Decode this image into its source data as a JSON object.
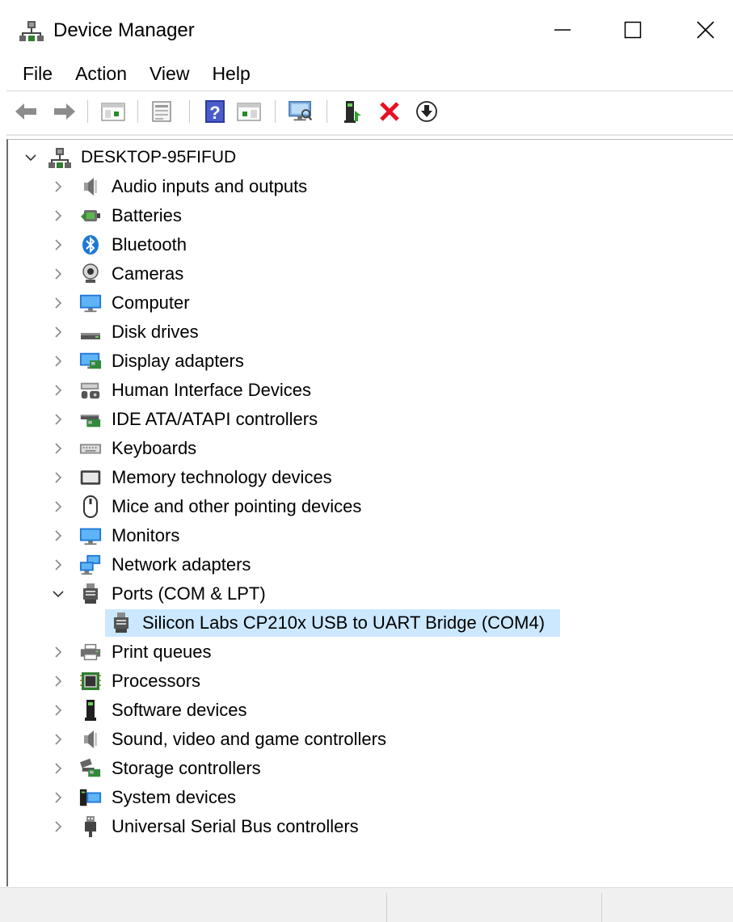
{
  "window": {
    "title": "Device Manager",
    "app_icon": "device-manager-icon",
    "controls": [
      "minimize-icon",
      "maximize-icon",
      "close-icon"
    ]
  },
  "menu": [
    "File",
    "Action",
    "View",
    "Help"
  ],
  "toolbar": [
    "back-arrow-icon",
    "forward-arrow-icon",
    "show-hide-console-tree-icon",
    "properties-icon",
    "help-icon",
    "action-pane-icon",
    "monitor-scan-icon",
    "update-driver-icon",
    "uninstall-x-icon",
    "download-driver-icon"
  ],
  "tree": {
    "root": "DESKTOP-95FIFUD",
    "categories": [
      {
        "label": "Audio inputs and outputs",
        "icon": "speaker-icon"
      },
      {
        "label": "Batteries",
        "icon": "battery-icon"
      },
      {
        "label": "Bluetooth",
        "icon": "bluetooth-icon"
      },
      {
        "label": "Cameras",
        "icon": "camera-icon"
      },
      {
        "label": "Computer",
        "icon": "computer-icon"
      },
      {
        "label": "Disk drives",
        "icon": "disk-drive-icon"
      },
      {
        "label": "Display adapters",
        "icon": "display-adapter-icon"
      },
      {
        "label": "Human Interface Devices",
        "icon": "hid-icon"
      },
      {
        "label": "IDE ATA/ATAPI controllers",
        "icon": "ide-controller-icon"
      },
      {
        "label": "Keyboards",
        "icon": "keyboard-icon"
      },
      {
        "label": "Memory technology devices",
        "icon": "memory-device-icon"
      },
      {
        "label": "Mice and other pointing devices",
        "icon": "mouse-icon"
      },
      {
        "label": "Monitors",
        "icon": "monitor-icon"
      },
      {
        "label": "Network adapters",
        "icon": "network-adapter-icon"
      },
      {
        "label": "Ports (COM & LPT)",
        "icon": "port-icon",
        "expanded": true,
        "children": [
          {
            "label": "Silicon Labs CP210x USB to UART Bridge (COM4)",
            "icon": "port-icon",
            "selected": true
          }
        ]
      },
      {
        "label": "Print queues",
        "icon": "printer-icon"
      },
      {
        "label": "Processors",
        "icon": "processor-icon"
      },
      {
        "label": "Software devices",
        "icon": "software-device-icon"
      },
      {
        "label": "Sound, video and game controllers",
        "icon": "speaker-icon"
      },
      {
        "label": "Storage controllers",
        "icon": "storage-controller-icon"
      },
      {
        "label": "System devices",
        "icon": "system-devices-icon"
      },
      {
        "label": "Universal Serial Bus controllers",
        "icon": "usb-icon"
      }
    ]
  },
  "colors": {
    "selection": "#cce8ff",
    "accent": "#1e78d6",
    "uninstall": "#e81123"
  }
}
